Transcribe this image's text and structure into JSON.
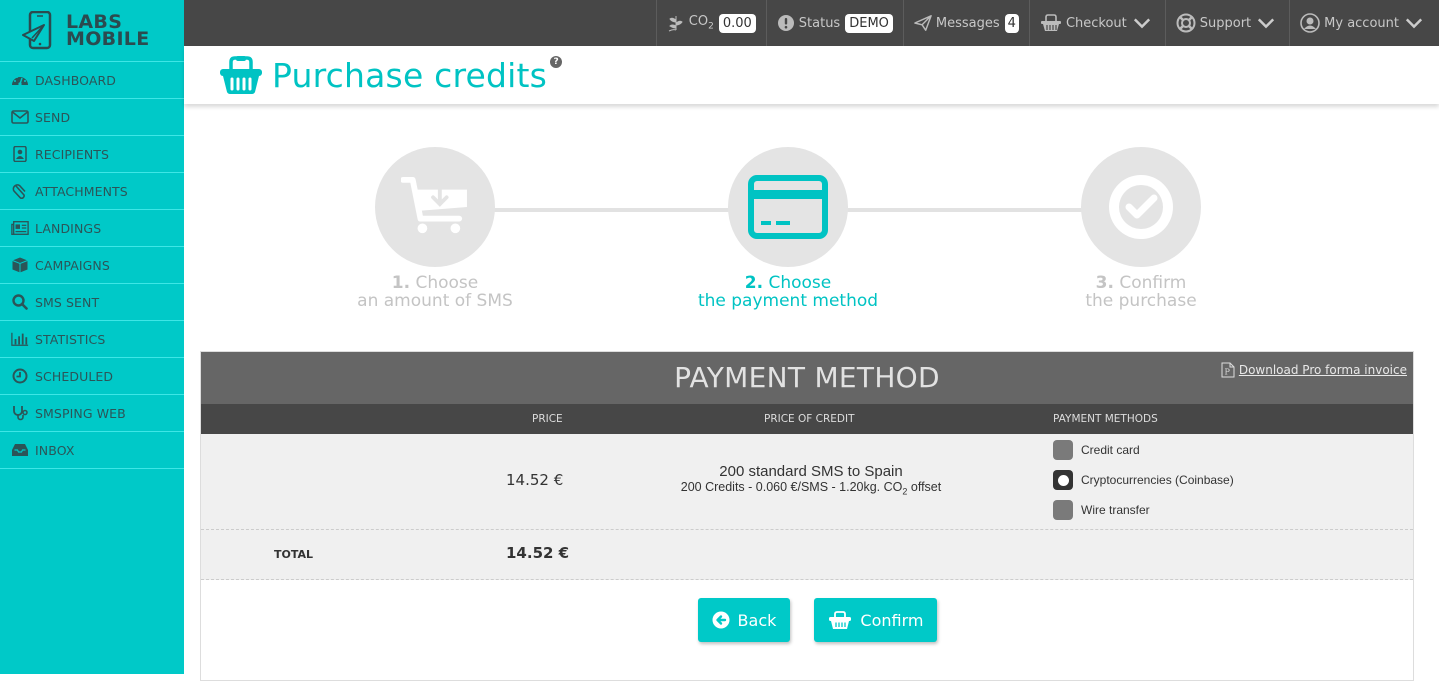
{
  "brand": {
    "line1": "LABS",
    "line2": "MOBILE"
  },
  "sidebar": {
    "items": [
      {
        "label": "DASHBOARD",
        "icon": "dashboard-icon"
      },
      {
        "label": "SEND",
        "icon": "envelope-icon"
      },
      {
        "label": "RECIPIENTS",
        "icon": "contacts-icon"
      },
      {
        "label": "ATTACHMENTS",
        "icon": "paperclip-icon"
      },
      {
        "label": "LANDINGS",
        "icon": "newspaper-icon"
      },
      {
        "label": "CAMPAIGNS",
        "icon": "cube-icon"
      },
      {
        "label": "SMS SENT",
        "icon": "search-icon"
      },
      {
        "label": "STATISTICS",
        "icon": "bar-chart-icon"
      },
      {
        "label": "SCHEDULED",
        "icon": "clock-icon"
      },
      {
        "label": "SMSPING WEB",
        "icon": "stethoscope-icon"
      },
      {
        "label": "INBOX",
        "icon": "inbox-icon"
      }
    ]
  },
  "topbar": {
    "co2_label": "CO",
    "co2_sub": "2",
    "co2_value": "0.00",
    "status_label": "Status",
    "status_value": "DEMO",
    "messages_label": "Messages",
    "messages_count": "4",
    "checkout_label": "Checkout",
    "support_label": "Support",
    "account_label": "My account"
  },
  "header": {
    "title": "Purchase credits",
    "help": "?"
  },
  "steps": [
    {
      "num": "1.",
      "line1": "Choose",
      "line2": "an amount of SMS",
      "state": "done"
    },
    {
      "num": "2.",
      "line1": "Choose",
      "line2": "the payment method",
      "state": "active"
    },
    {
      "num": "3.",
      "line1": "Confirm",
      "line2": "the purchase",
      "state": "pending"
    }
  ],
  "panel": {
    "title": "PAYMENT METHOD",
    "download_link": "Download Pro forma invoice",
    "columns": {
      "price": "PRICE",
      "price_of_credit": "PRICE OF CREDIT",
      "payment_methods": "PAYMENT METHODS"
    },
    "row": {
      "price": "14.52 €",
      "desc_main": "200 standard SMS to Spain",
      "desc_sub_pre": "200 Credits - 0.060 €/SMS - 1.20kg. CO",
      "desc_sub_sub": "2",
      "desc_sub_post": " offset"
    },
    "payment_methods": [
      {
        "label": "Credit card",
        "selected": false
      },
      {
        "label": "Cryptocurrencies (Coinbase)",
        "selected": true
      },
      {
        "label": "Wire transfer",
        "selected": false
      }
    ],
    "total_label": "TOTAL",
    "total_value": "14.52 €"
  },
  "actions": {
    "back": "Back",
    "confirm": "Confirm"
  },
  "colors": {
    "accent": "#00c9c8",
    "topbar": "#474747",
    "panel_header": "#666666",
    "table_header": "#474747"
  }
}
